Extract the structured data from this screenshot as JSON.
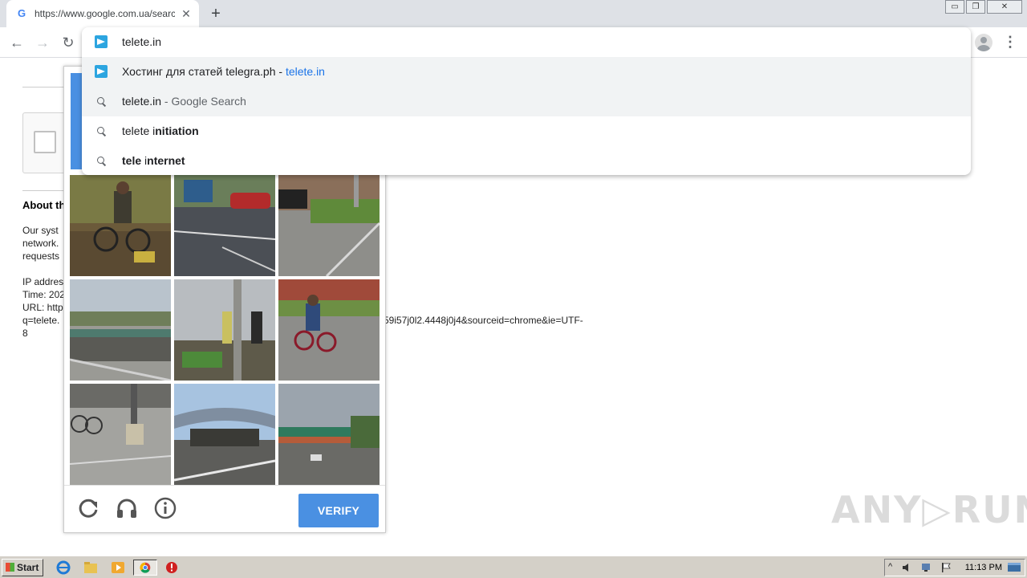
{
  "browser": {
    "tab_title": "https://www.google.com.ua/search?",
    "tab_favicon": "G",
    "tab_close": "✕",
    "new_tab": "+",
    "window_buttons": [
      "▭",
      "❐",
      "✕"
    ]
  },
  "toolbar": {
    "back": "←",
    "forward": "→",
    "reload": "↻",
    "menu": "⋮"
  },
  "omnibox": {
    "input_value": "telete.in",
    "suggestions": [
      {
        "icon": "telegram-icon",
        "text": "Хостинг для статей telegra.ph - ",
        "url": "telete.in"
      },
      {
        "icon": "search-icon",
        "text": "telete.in",
        "suffix": " - Google Search"
      },
      {
        "icon": "search-icon",
        "prefix": "telete i",
        "bold": "nitiation"
      },
      {
        "icon": "search-icon",
        "bold_a": "tele ",
        "plain": "i",
        "bold_b": "nternet"
      }
    ]
  },
  "page": {
    "about_title": "About th",
    "para1": [
      "Our syst",
      "network.",
      "requests"
    ],
    "info": [
      "IP addres",
      "Time: 202",
      "URL: http",
      "q=telete.",
      "8"
    ],
    "url_tail": "59i57j0l2.4448j0j4&sourceid=chrome&ie=UTF-"
  },
  "captcha": {
    "verify_label": "VERIFY"
  },
  "watermark": "ANY▷RUN",
  "taskbar": {
    "start_label": "Start",
    "clock": "11:13 PM"
  },
  "colors": {
    "accent": "#4a90e2",
    "telegram": "#2ca5e0",
    "link": "#1a73e8"
  }
}
